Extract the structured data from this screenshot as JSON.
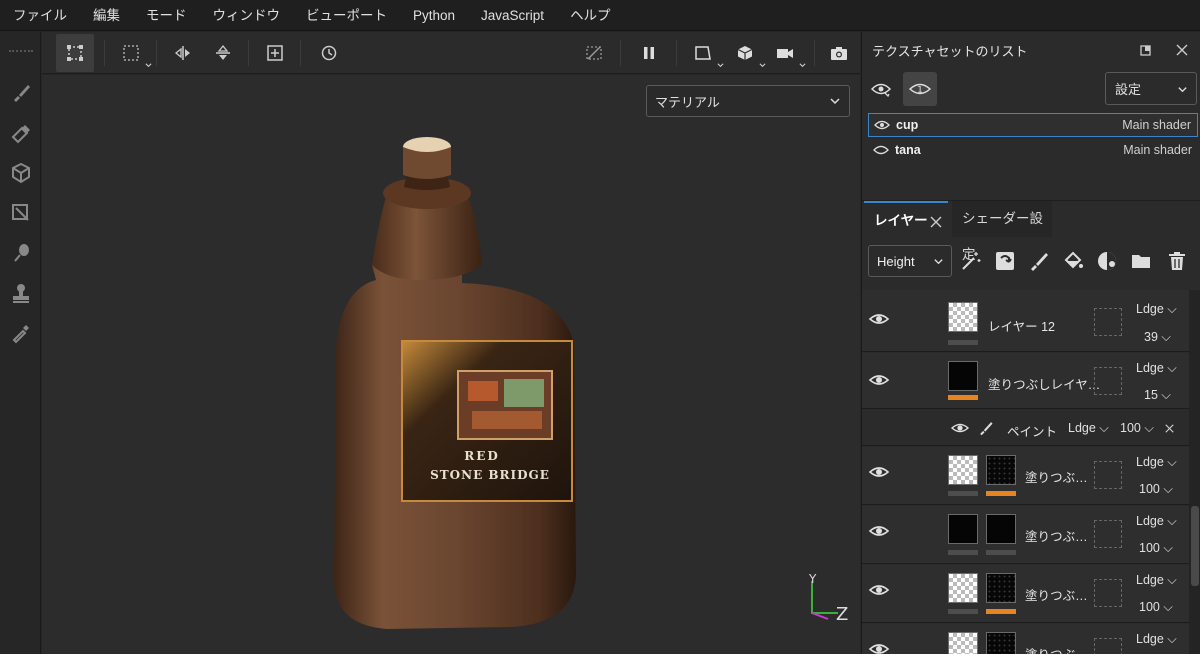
{
  "menu": [
    "ファイル",
    "編集",
    "モード",
    "ウィンドウ",
    "ビューポート",
    "Python",
    "JavaScript",
    "ヘルプ"
  ],
  "viewport": {
    "material_select": "マテリアル",
    "label_line1": "RED",
    "label_line2": "STONE BRIDGE",
    "gizmo_y": "Y",
    "gizmo_z": "Z"
  },
  "texture_set_panel": {
    "title": "テクスチャセットのリスト",
    "settings_label": "設定",
    "sets": [
      {
        "name": "cup",
        "shader": "Main shader",
        "selected": true
      },
      {
        "name": "tana",
        "shader": "Main shader",
        "selected": false
      }
    ]
  },
  "tabs": {
    "layers": "レイヤー",
    "shader_settings": "シェーダー設定"
  },
  "layer_channel": "Height",
  "layers": [
    {
      "name": "レイヤー 12",
      "blend": "Ldge",
      "opacity": "39"
    },
    {
      "name": "塗りつぶしレイヤ…",
      "blend": "Ldge",
      "opacity": "15"
    },
    {
      "name": "塗りつぶ…",
      "blend": "Ldge",
      "opacity": "100"
    },
    {
      "name": "塗りつぶ…",
      "blend": "Ldge",
      "opacity": "100"
    },
    {
      "name": "塗りつぶ…",
      "blend": "Ldge",
      "opacity": "100"
    },
    {
      "name": "塗りつぶ…",
      "blend": "Ldge",
      "opacity": ""
    }
  ],
  "paint_effect": {
    "name": "ペイント",
    "blend": "Ldge",
    "opacity": "100"
  },
  "colors": {
    "accent_blue": "#3a86c8",
    "mask_orange": "#e8841f"
  }
}
